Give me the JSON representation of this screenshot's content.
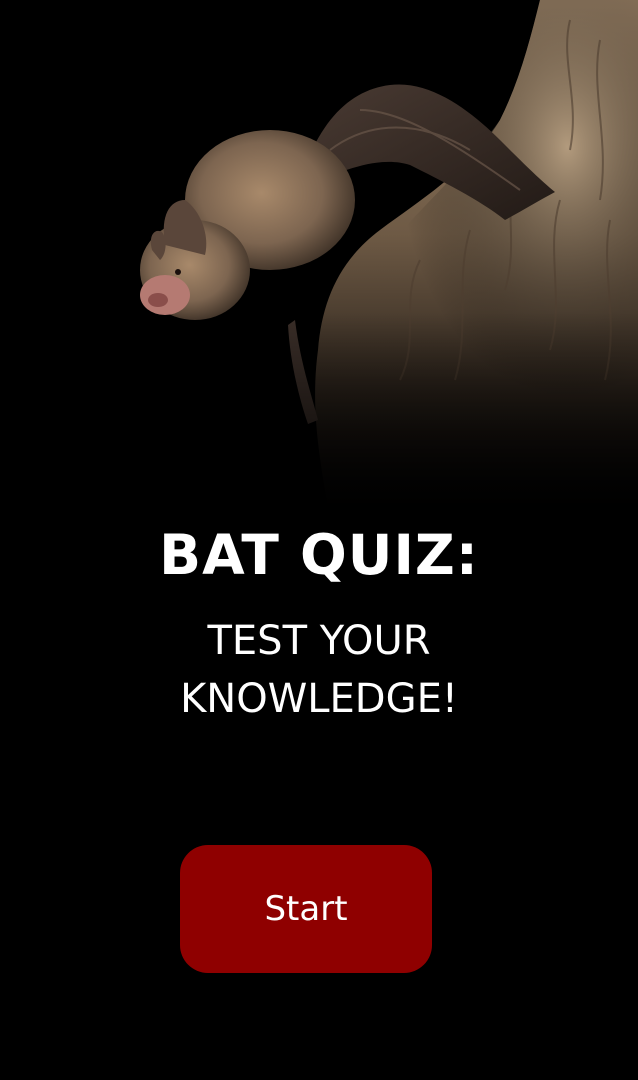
{
  "hero": {
    "image_icon": "bat-on-tree-photo"
  },
  "quiz": {
    "title": "BAT QUIZ:",
    "subtitle_line1": "TEST YOUR",
    "subtitle_line2": "KNOWLEDGE!",
    "start_label": "Start"
  },
  "colors": {
    "background": "#000000",
    "button": "#8f0000",
    "text": "#ffffff"
  }
}
